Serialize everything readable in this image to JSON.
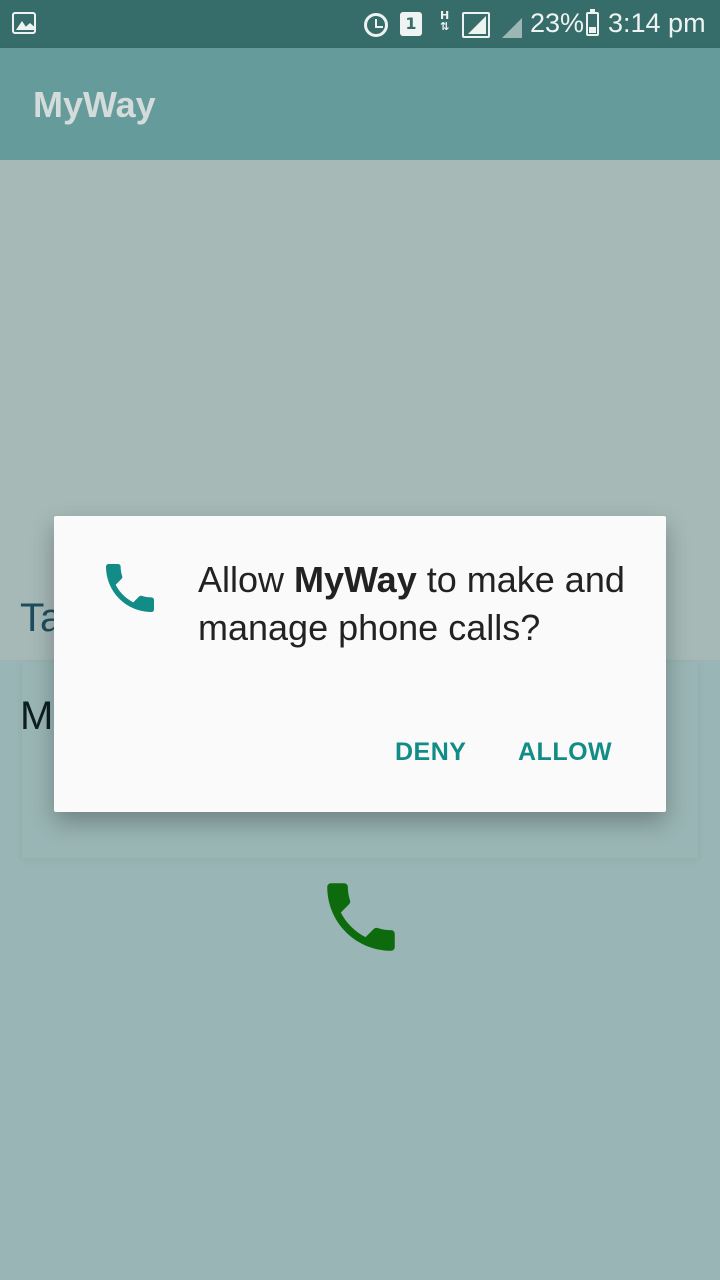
{
  "status_bar": {
    "sim_slot": "1",
    "network_type": "H",
    "battery": "23%",
    "time": "3:14 pm",
    "icons": [
      "gallery-icon",
      "alarm-icon",
      "sim-icon",
      "h-data-icon",
      "signal-icon",
      "signal-icon-2",
      "battery-icon"
    ]
  },
  "app_bar": {
    "title": "MyWay"
  },
  "background": {
    "heading_partial": "Ta",
    "item_partial": "M",
    "phone_icon": "phone-icon"
  },
  "dialog": {
    "message_prefix": "Allow ",
    "app_name": "MyWay",
    "message_suffix": " to make and manage phone calls?",
    "deny_label": "DENY",
    "allow_label": "ALLOW",
    "icon": "phone-icon"
  },
  "colors": {
    "accent": "#128c86",
    "status_bar": "#366d6a",
    "app_bar": "#669b9b",
    "background_phone": "#0d6b0d"
  }
}
